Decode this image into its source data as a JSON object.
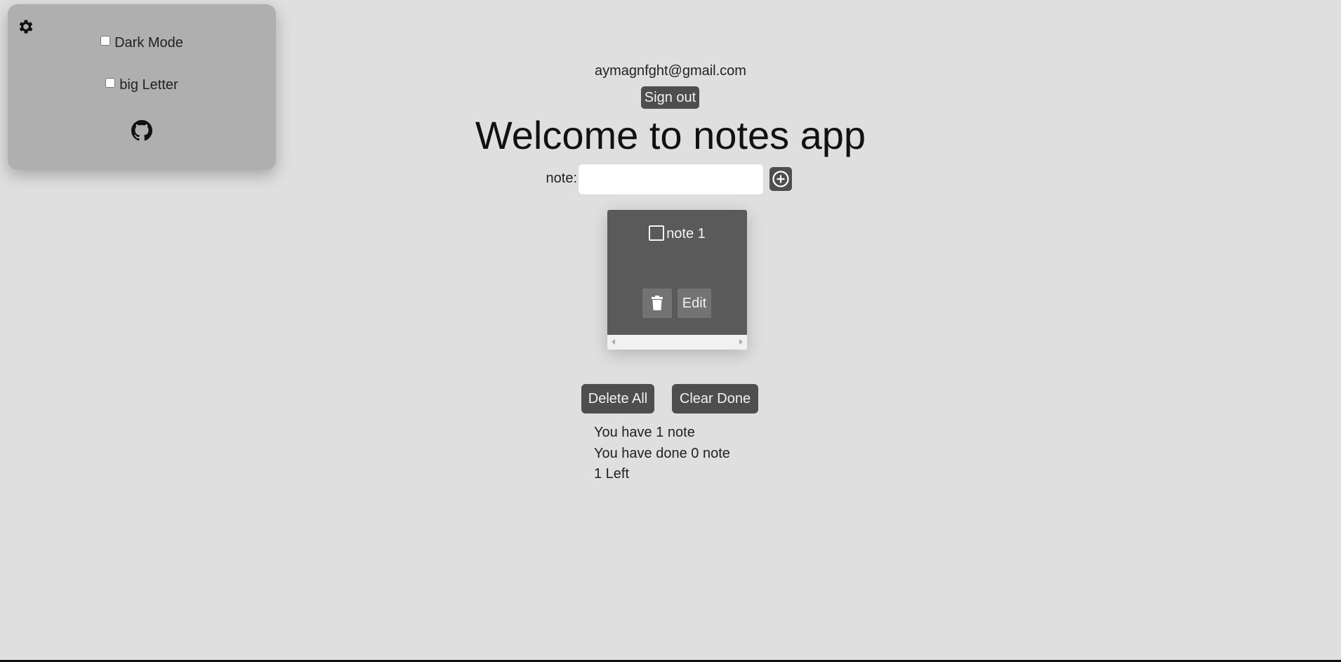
{
  "settings": {
    "icon": "gear-icon",
    "dark_mode_label": "Dark Mode",
    "dark_mode_checked": false,
    "big_letter_label": "big Letter",
    "big_letter_checked": false,
    "github_icon": "github-icon"
  },
  "header": {
    "email": "aymagnfght@gmail.com",
    "sign_out_label": "Sign out",
    "title": "Welcome to notes app"
  },
  "add_note": {
    "label": "note:",
    "value": "",
    "placeholder": "",
    "add_icon": "plus-circle-icon"
  },
  "notes": [
    {
      "text": "note 1",
      "done": false,
      "edit_label": "Edit",
      "delete_icon": "trash-icon"
    }
  ],
  "actions": {
    "delete_all_label": "Delete All",
    "clear_done_label": "Clear Done"
  },
  "stats": {
    "total": "You have 1 note",
    "done": "You have done 0 note",
    "left": "1 Left"
  },
  "colors": {
    "background": "#dfdfdf",
    "panel": "#afafaf",
    "button": "#4e4e4e",
    "card": "#5a5a5a"
  }
}
